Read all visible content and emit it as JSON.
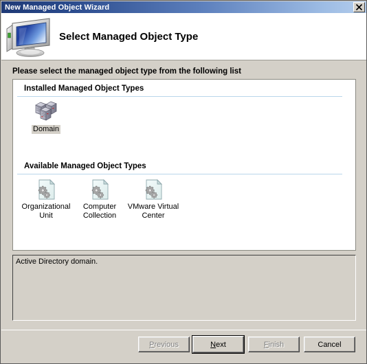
{
  "window": {
    "title": "New Managed Object Wizard",
    "close_icon": "close-icon"
  },
  "header": {
    "title": "Select Managed Object Type",
    "icon": "computer-monitor-icon"
  },
  "main": {
    "instruction": "Please select the managed object type from the following list",
    "sections": [
      {
        "title": "Installed Managed Object Types",
        "items": [
          {
            "label": "Domain",
            "icon": "server-stack-icon",
            "selected": true
          }
        ]
      },
      {
        "title": "Available Managed Object Types",
        "items": [
          {
            "label": "Organizational\nUnit",
            "icon": "document-gears-icon",
            "selected": false
          },
          {
            "label": "Computer\nCollection",
            "icon": "document-gears-icon",
            "selected": false
          },
          {
            "label": "VMware Virtual\nCenter",
            "icon": "document-gears-icon",
            "selected": false
          }
        ]
      }
    ],
    "description": "Active Directory domain."
  },
  "footer": {
    "buttons": [
      {
        "label": "Previous",
        "accel": "P",
        "enabled": false,
        "default": false
      },
      {
        "label": "Next",
        "accel": "N",
        "enabled": true,
        "default": true
      },
      {
        "label": "Finish",
        "accel": "F",
        "enabled": false,
        "default": false
      },
      {
        "label": "Cancel",
        "accel": "",
        "enabled": true,
        "default": false
      }
    ]
  },
  "colors": {
    "titlebar_start": "#1f3a76",
    "titlebar_end": "#b4cdec",
    "dialog_face": "#d4d0c8",
    "panel": "#ffffff",
    "section_rule": "#b8d6ea"
  }
}
